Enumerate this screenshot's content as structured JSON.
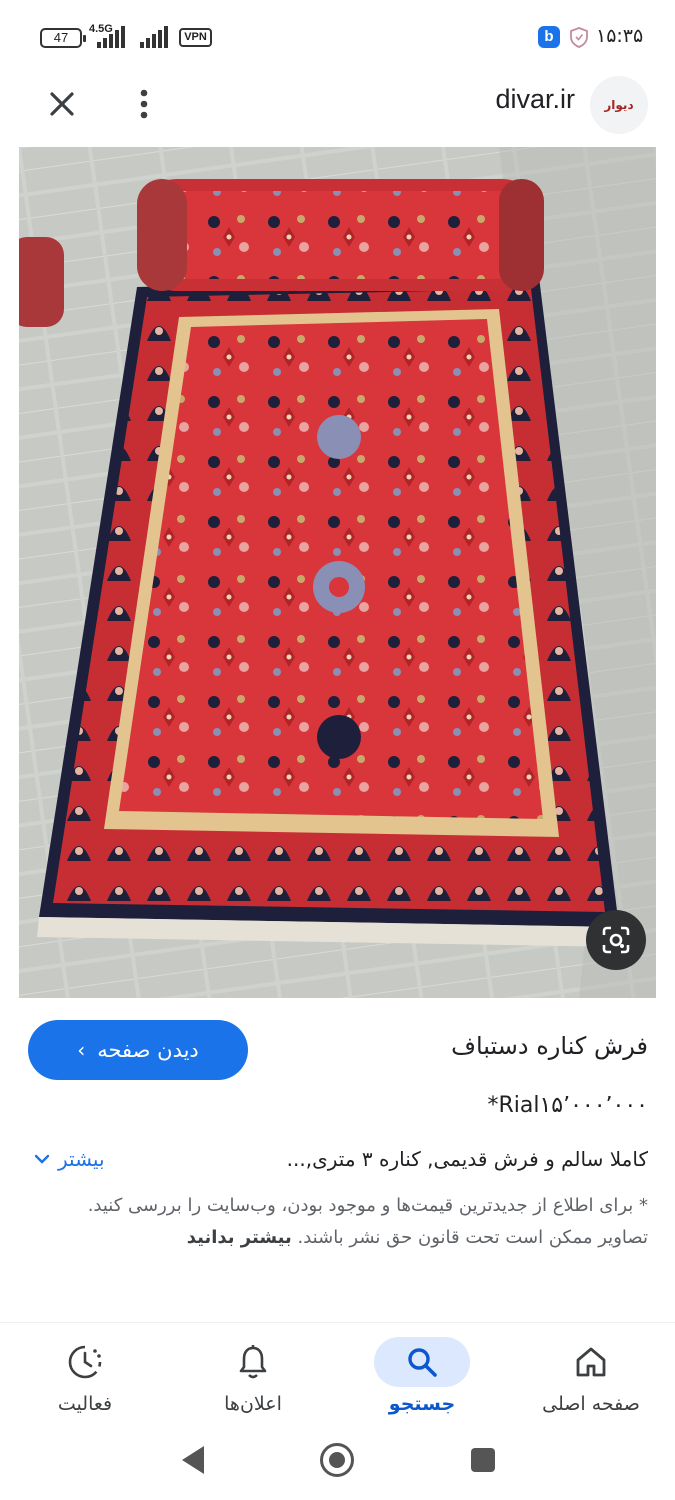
{
  "status_bar": {
    "battery": "47",
    "network": "4.5G",
    "vpn": "VPN",
    "time": "۱۵:۳۵",
    "app_badge": "b"
  },
  "header": {
    "site": "divar.ir",
    "logo_text": "دیوار",
    "close_icon": "close-icon",
    "menu_icon": "more-vert-icon"
  },
  "image": {
    "subject": "hand-knotted red Persian runner carpet",
    "lens_icon": "lens-icon"
  },
  "result": {
    "title": "فرش کناره دستباف",
    "price": "*Rial۱۵٬۰۰۰٬۰۰۰",
    "visit_label": "دیدن صفحه",
    "description": "کاملا سالم و فرش قدیمی, کناره ۳ متری,...",
    "more_label": "بیشتر",
    "notice_text": "* برای اطلاع از جدیدترین قیمت‌ها و موجود بودن، وب‌سایت را بررسی کنید. تصاویر ممکن است تحت قانون حق نشر باشند.",
    "notice_link": "بیشتر بدانید"
  },
  "bottom_nav": [
    {
      "label": "فعالیت",
      "icon": "activity-icon"
    },
    {
      "label": "اعلان‌ها",
      "icon": "bell-icon"
    },
    {
      "label": "جستجو",
      "icon": "search-icon",
      "active": true
    },
    {
      "label": "صفحه اصلی",
      "icon": "home-icon"
    }
  ],
  "colors": {
    "accent": "#1a73e8",
    "active_pill": "#dce8fd",
    "carpet_red": "#d8363a",
    "carpet_navy": "#1e1f3a"
  }
}
